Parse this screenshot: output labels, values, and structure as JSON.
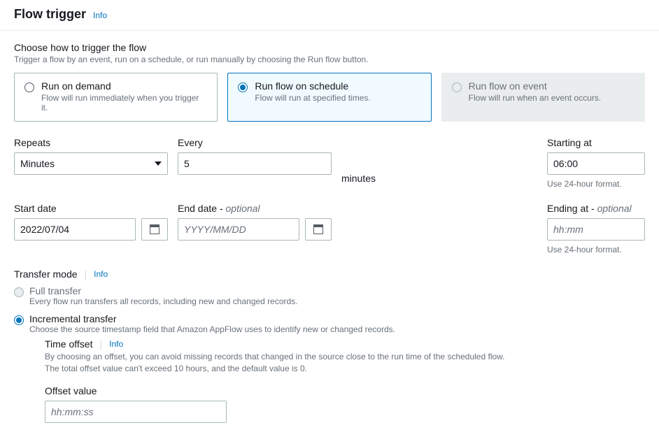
{
  "header": {
    "title": "Flow trigger",
    "info": "Info"
  },
  "trigger_choice": {
    "label": "Choose how to trigger the flow",
    "help": "Trigger a flow by an event, run on a schedule, or run manually by choosing the Run flow button.",
    "options": [
      {
        "label": "Run on demand",
        "desc": "Flow will run immediately when you trigger it.",
        "selected": false,
        "disabled": false
      },
      {
        "label": "Run flow on schedule",
        "desc": "Flow will run at specified times.",
        "selected": true,
        "disabled": false
      },
      {
        "label": "Run flow on event",
        "desc": "Flow will run when an event occurs.",
        "selected": false,
        "disabled": true
      }
    ]
  },
  "schedule": {
    "repeats_label": "Repeats",
    "repeats_value": "Minutes",
    "every_label": "Every",
    "every_value": "5",
    "every_unit": "minutes",
    "starting_label": "Starting at",
    "starting_value": "06:00",
    "starting_hint": "Use 24-hour format.",
    "start_date_label": "Start date",
    "start_date_value": "2022/07/04",
    "end_date_label": "End date - ",
    "end_date_optional": "optional",
    "end_date_placeholder": "YYYY/MM/DD",
    "ending_label": "Ending at - ",
    "ending_optional": "optional",
    "ending_placeholder": "hh:mm",
    "ending_hint": "Use 24-hour format."
  },
  "transfer_mode": {
    "title": "Transfer mode",
    "info": "Info",
    "full": {
      "label": "Full transfer",
      "desc": "Every flow run transfers all records, including new and changed records."
    },
    "incremental": {
      "label": "Incremental transfer",
      "desc": "Choose the source timestamp field that Amazon AppFlow uses to identify new or changed records."
    },
    "time_offset": {
      "title": "Time offset",
      "info": "Info",
      "desc_line1": "By choosing an offset, you can avoid missing records that changed in the source close to the run time of the scheduled flow.",
      "desc_line2": "The total offset value can't exceed 10 hours, and the default value is 0.",
      "value_label": "Offset value",
      "value_placeholder": "hh:mm:ss"
    }
  }
}
